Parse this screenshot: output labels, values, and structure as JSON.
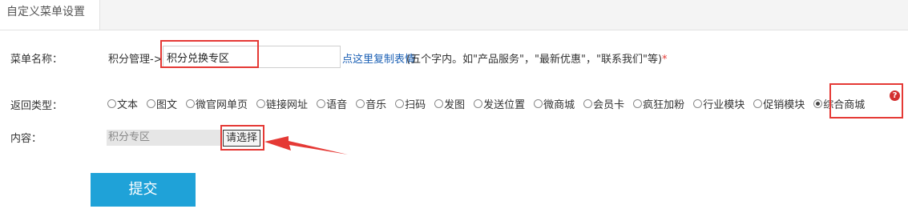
{
  "tab": {
    "label": "自定义菜单设置"
  },
  "form": {
    "menu_name_label": "菜单名称：",
    "menu_name_prefix": "积分管理->",
    "menu_name_value": "积分兑换专区",
    "copy_link": "点这里复制表情",
    "hint": "(五个字内。如\"产品服务\"，\"最新优惠\"，\"联系我们\"等)",
    "required_mark": "*",
    "return_type_label": "返回类型：",
    "return_types": [
      {
        "label": "文本",
        "checked": false
      },
      {
        "label": "图文",
        "checked": false
      },
      {
        "label": "微官网单页",
        "checked": false
      },
      {
        "label": "链接网址",
        "checked": false
      },
      {
        "label": "语音",
        "checked": false
      },
      {
        "label": "音乐",
        "checked": false
      },
      {
        "label": "扫码",
        "checked": false
      },
      {
        "label": "发图",
        "checked": false
      },
      {
        "label": "发送位置",
        "checked": false
      },
      {
        "label": "微商城",
        "checked": false
      },
      {
        "label": "会员卡",
        "checked": false
      },
      {
        "label": "疯狂加粉",
        "checked": false
      },
      {
        "label": "行业模块",
        "checked": false
      },
      {
        "label": "促销模块",
        "checked": false
      },
      {
        "label": "综合商城",
        "checked": true
      }
    ],
    "help_icon_glyph": "?",
    "content_label": "内容：",
    "content_value": "积分专区",
    "choose_button": "请选择",
    "submit_button": "提交"
  },
  "colors": {
    "accent": "#1fa2d8",
    "highlight": "#e53935",
    "link": "#1a5fb4"
  }
}
